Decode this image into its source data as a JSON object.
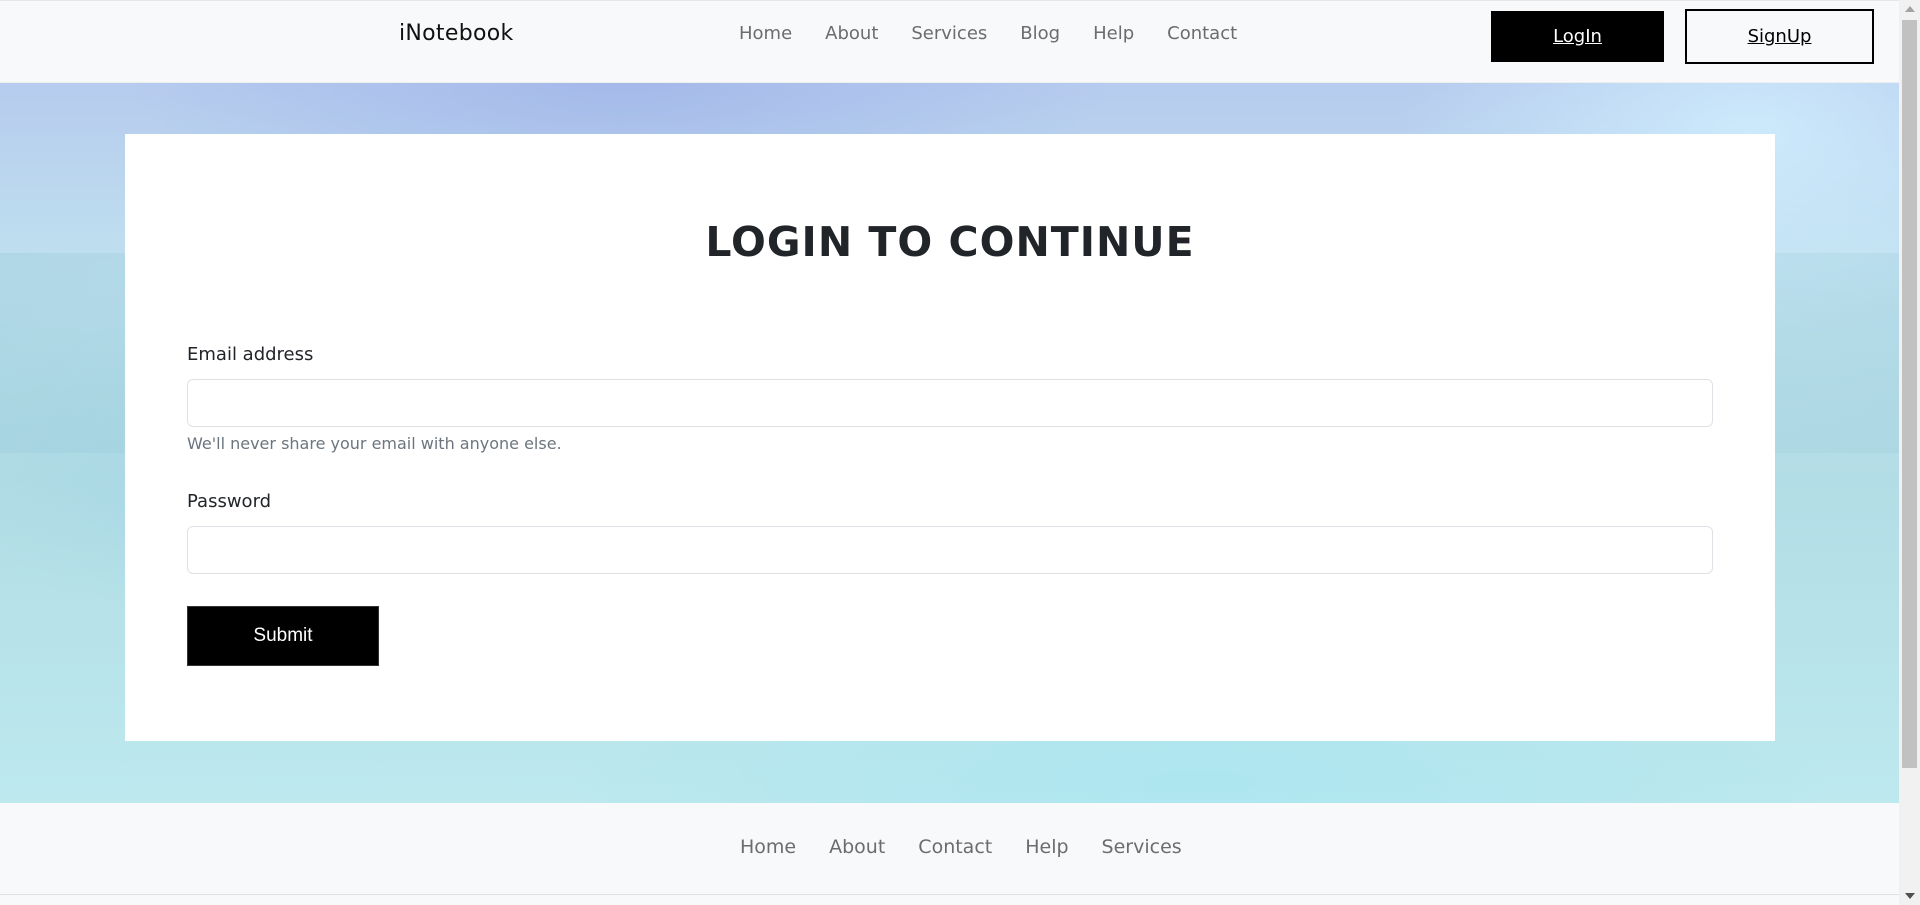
{
  "navbar": {
    "brand": "iNotebook",
    "links": [
      "Home",
      "About",
      "Services",
      "Blog",
      "Help",
      "Contact"
    ],
    "login_label": "LogIn",
    "signup_label": "SignUp"
  },
  "form": {
    "title": "LOGIN TO CONTINUE",
    "email_label": "Email address",
    "email_value": "",
    "email_help": "We'll never share your email with anyone else.",
    "password_label": "Password",
    "password_value": "",
    "submit_label": "Submit"
  },
  "footer": {
    "links": [
      "Home",
      "About",
      "Contact",
      "Help",
      "Services"
    ]
  },
  "colors": {
    "primary_button": "#000000",
    "navbar_bg": "#f8f9fa",
    "card_bg": "#ffffff"
  }
}
